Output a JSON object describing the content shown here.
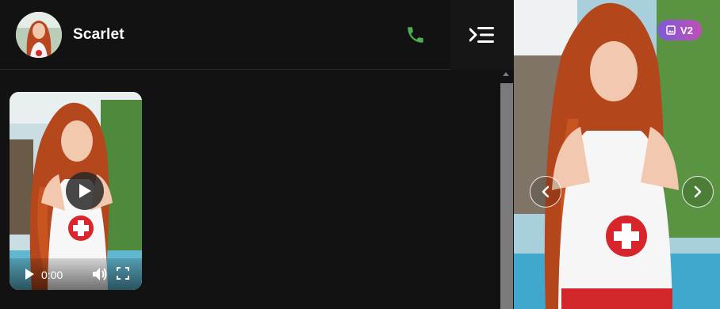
{
  "header": {
    "contact_name": "Scarlet",
    "avatar_icon": "avatar-photo",
    "call_icon": "phone-icon",
    "menu_icon": "menu-collapse-icon",
    "call_color": "#4caf50"
  },
  "video_message": {
    "play_icon": "play-icon",
    "time": "0:00",
    "volume_icon": "volume-icon",
    "fullscreen_icon": "fullscreen-icon"
  },
  "gallery": {
    "badge_label": "V2",
    "badge_icon": "image-icon",
    "prev_icon": "chevron-left-icon",
    "next_icon": "chevron-right-icon"
  },
  "colors": {
    "background": "#121212",
    "accent_gradient_start": "#7d5bd6",
    "accent_gradient_end": "#c04fb8"
  }
}
